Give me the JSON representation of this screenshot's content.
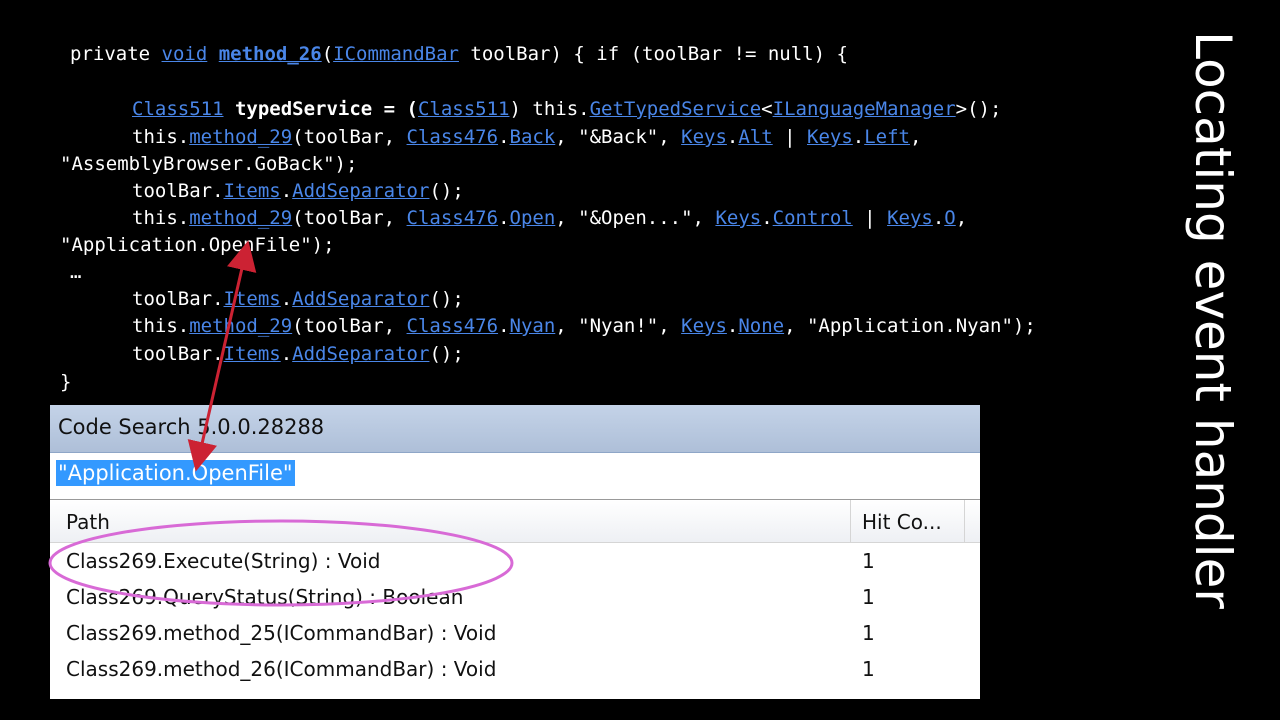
{
  "slide_title": "Locating event handler",
  "code": {
    "l1": {
      "kw": "private ",
      "t1": "void",
      "s1": " ",
      "t2": "method_26",
      "s2": "(",
      "t3": "ICommandBar",
      "s3": " toolBar) { if (toolBar != null) {"
    },
    "l2": {
      "t1": "Class511",
      "s1": " typedService = (",
      "t2": "Class511",
      "s2": ") this.",
      "t3": "GetTypedService",
      "s3": "<",
      "t4": "ILanguageManager",
      "s4": ">();"
    },
    "l3": {
      "s0": "this.",
      "t1": "method_29",
      "s1": "(toolBar, ",
      "t2": "Class476",
      "s2": ".",
      "t3": "Back",
      "s3": ", \"&Back\", ",
      "t4": "Keys",
      "s4": ".",
      "t5": "Alt",
      "s5": " | ",
      "t6": "Keys",
      "s6": ".",
      "t7": "Left",
      "s7": ","
    },
    "l4": "\"AssemblyBrowser.GoBack\");",
    "l5": {
      "s0": "toolBar.",
      "t1": "Items",
      "s1": ".",
      "t2": "AddSeparator",
      "s2": "();"
    },
    "l6": {
      "s0": "this.",
      "t1": "method_29",
      "s1": "(toolBar, ",
      "t2": "Class476",
      "s2": ".",
      "t3": "Open",
      "s3": ", \"&Open...\", ",
      "t4": "Keys",
      "s4": ".",
      "t5": "Control",
      "s5": " | ",
      "t6": "Keys",
      "s6": ".",
      "t7": "O",
      "s7": ","
    },
    "l7": "\"Application.OpenFile\");",
    "l8": "…",
    "l9": {
      "s0": "toolBar.",
      "t1": "Items",
      "s1": ".",
      "t2": "AddSeparator",
      "s2": "();"
    },
    "l10": {
      "s0": "this.",
      "t1": "method_29",
      "s1": "(toolBar, ",
      "t2": "Class476",
      "s2": ".",
      "t3": "Nyan",
      "s3": ", \"Nyan!\", ",
      "t4": "Keys",
      "s4": ".",
      "t5": "None",
      "s5": ", \"Application.Nyan\");"
    },
    "l11": {
      "s0": "toolBar.",
      "t1": "Items",
      "s1": ".",
      "t2": "AddSeparator",
      "s2": "();"
    },
    "l12": "}"
  },
  "window": {
    "title": "Code Search 5.0.0.28288",
    "search_value": "\"Application.OpenFile\"",
    "columns": {
      "path": "Path",
      "hits": "Hit Co..."
    },
    "rows": [
      {
        "path": "Class269.Execute(String) : Void",
        "hits": "1"
      },
      {
        "path": "Class269.QueryStatus(String) : Boolean",
        "hits": "1"
      },
      {
        "path": "Class269.method_25(ICommandBar) : Void",
        "hits": "1"
      },
      {
        "path": "Class269.method_26(ICommandBar) : Void",
        "hits": "1"
      }
    ]
  },
  "colors": {
    "link": "#4a86e8",
    "arrow": "#cc2233",
    "ellipse": "#d86ad6",
    "background": "#000000"
  }
}
